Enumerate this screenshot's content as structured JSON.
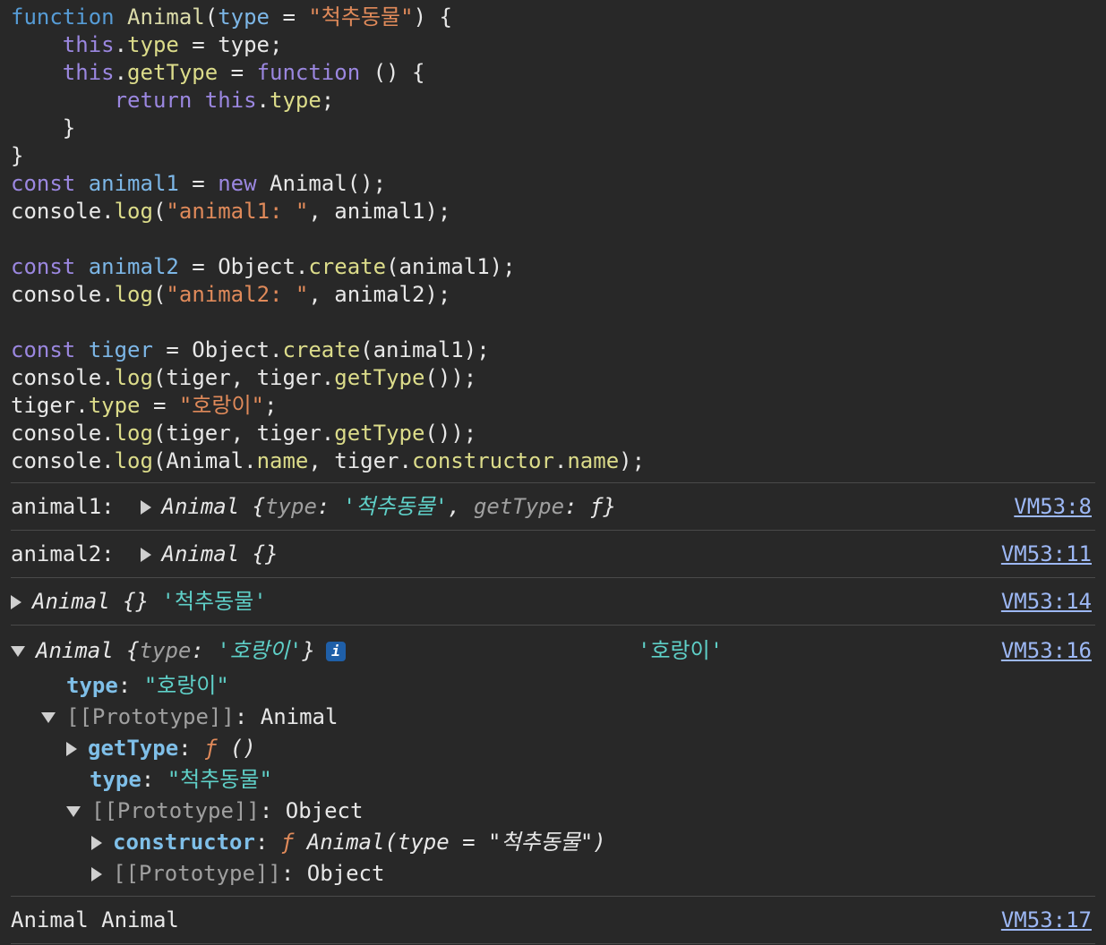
{
  "code": {
    "l1": {
      "k": "function",
      "fn": "Animal",
      "p1": "(",
      "param": "type",
      "eq": " = ",
      "str": "\"척추동물\"",
      "tail": ") {"
    },
    "l2": {
      "indent": "    ",
      "this": "this",
      "dot": ".",
      "prop": "type",
      "rest": " = type;"
    },
    "l3": {
      "indent": "    ",
      "this": "this",
      "dot": ".",
      "prop": "getType",
      "eq": " = ",
      "k": "function",
      "rest": " () {"
    },
    "l4": {
      "indent": "        ",
      "ret": "return",
      "sp": " ",
      "this": "this",
      "dot": ".",
      "prop": "type",
      "rest": ";"
    },
    "l5": "    }",
    "l6": "}",
    "l7": {
      "k": "const",
      "sp": " ",
      "v": "animal1",
      "eq": " = ",
      "n": "new",
      "rest": " Animal();"
    },
    "l8": {
      "obj": "console",
      "dot": ".",
      "m": "log",
      "p": "(",
      "str": "\"animal1: \"",
      "rest": ", animal1);"
    },
    "l10": {
      "k": "const",
      "sp": " ",
      "v": "animal2",
      "eq": " = Object.",
      "m": "create",
      "rest": "(animal1);"
    },
    "l11": {
      "obj": "console",
      "dot": ".",
      "m": "log",
      "p": "(",
      "str": "\"animal2: \"",
      "rest": ", animal2);"
    },
    "l13": {
      "k": "const",
      "sp": " ",
      "v": "tiger",
      "eq": " = Object.",
      "m": "create",
      "rest": "(animal1);"
    },
    "l14": {
      "obj": "console",
      "dot": ".",
      "m": "log",
      "p": "(tiger, tiger.",
      "m2": "getType",
      "rest": "());"
    },
    "l15": {
      "obj": "tiger",
      "dot": ".",
      "prop": "type",
      "eq": " = ",
      "str": "\"호랑이\"",
      "rest": ";"
    },
    "l16": {
      "obj": "console",
      "dot": ".",
      "m": "log",
      "p": "(tiger, tiger.",
      "m2": "getType",
      "rest": "());"
    },
    "l17": {
      "obj": "console",
      "dot": ".",
      "m": "log",
      "p": "(Animal.",
      "p2": "name",
      "mid": ", tiger.",
      "p3": "constructor",
      "dot2": ".",
      "p4": "name",
      "rest": ");"
    }
  },
  "console": {
    "m1": {
      "label": "animal1:  ",
      "cls": "Animal",
      "open": " {",
      "k1": "type",
      "colon": ": ",
      "v1": "'척추동물'",
      "sep": ", ",
      "k2": "getType",
      "colon2": ": ",
      "f": "ƒ",
      "close": "}",
      "src": "VM53:8"
    },
    "m2": {
      "label": "animal2:  ",
      "cls": "Animal",
      "obj": " {}",
      "src": "VM53:11"
    },
    "m3": {
      "cls": "Animal",
      "obj": " {}",
      "val": " '척추동물'",
      "src": "VM53:14"
    },
    "m4": {
      "cls": "Animal",
      "open": " {",
      "k1": "type",
      "colon": ": ",
      "v1": "'호랑이'",
      "close": "}",
      "info": "i",
      "val": "'호랑이'",
      "src": "VM53:16",
      "r1": {
        "k": "type",
        "c": ": ",
        "v": "\"호랑이\""
      },
      "r2": {
        "k": "[[Prototype]]",
        "c": ": ",
        "v": "Animal"
      },
      "r3": {
        "k": "getType",
        "c": ": ",
        "f": "ƒ",
        "v": " ()"
      },
      "r4": {
        "k": "type",
        "c": ": ",
        "v": "\"척추동물\""
      },
      "r5": {
        "k": "[[Prototype]]",
        "c": ": ",
        "v": "Object"
      },
      "r6": {
        "k": "constructor",
        "c": ": ",
        "f": "ƒ",
        "v": " Animal(type = \"척추동물\")"
      },
      "r7": {
        "k": "[[Prototype]]",
        "c": ": ",
        "v": "Object"
      }
    },
    "m5": {
      "text": "Animal Animal",
      "src": "VM53:17"
    }
  }
}
